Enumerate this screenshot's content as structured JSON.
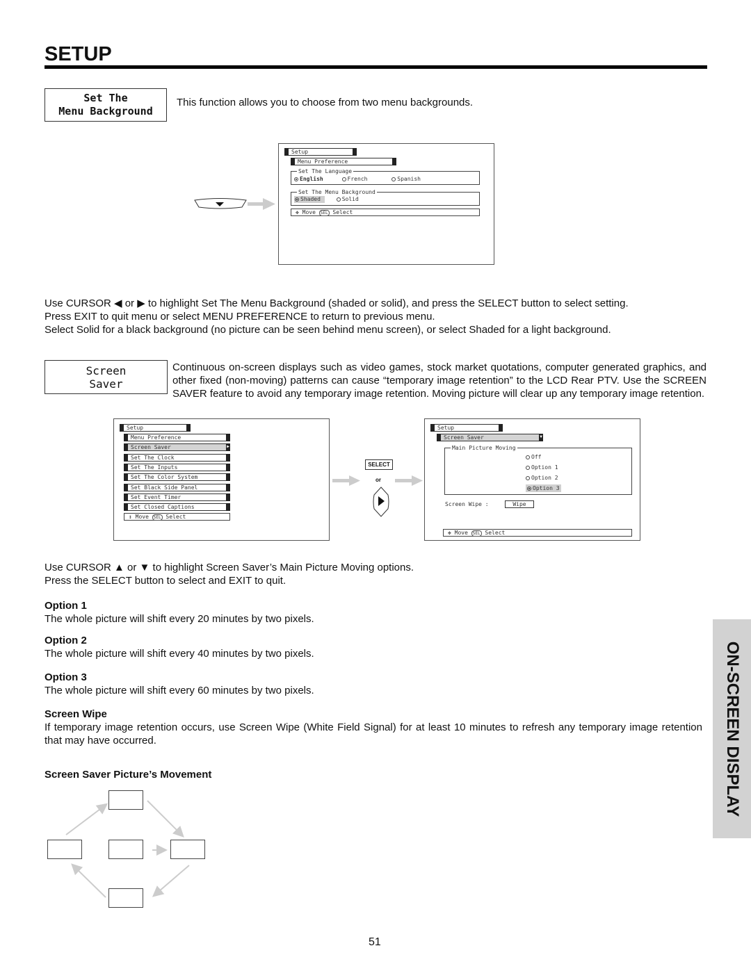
{
  "page": {
    "title": "SETUP",
    "page_number": "51",
    "side_tab": "ON-SCREEN DISPLAY"
  },
  "menu_background": {
    "label_line1": "Set The",
    "label_line2": "Menu Background",
    "intro": "This function allows you to choose from two menu backgrounds.",
    "osd": {
      "top": "Setup",
      "sub": "Menu Preference",
      "language_legend": "Set The Language",
      "languages": [
        {
          "label": "English",
          "selected": true
        },
        {
          "label": "French",
          "selected": false
        },
        {
          "label": "Spanish",
          "selected": false
        }
      ],
      "background_legend": "Set The Menu Background",
      "backgrounds": [
        {
          "label": "Shaded",
          "selected": true
        },
        {
          "label": "Solid",
          "selected": false
        }
      ],
      "footer_move": "Move",
      "footer_sel": "SEL",
      "footer_select": "Select"
    },
    "instructions": [
      "Use CURSOR ◀ or ▶ to highlight Set The Menu Background (shaded or solid), and press the SELECT button to select setting.",
      "Press EXIT to quit menu or select MENU PREFERENCE to return to previous menu.",
      "Select Solid for a black background (no picture can be seen behind menu screen), or select Shaded for a light background."
    ]
  },
  "screen_saver": {
    "label_line1": "Screen",
    "label_line2": "Saver",
    "intro": "Continuous on-screen displays such as video games, stock market quotations, computer generated graphics, and other fixed (non-moving) patterns can cause “temporary image retention” to the LCD Rear PTV.  Use the SCREEN SAVER feature to avoid any temporary image retention.  Moving picture will clear up any temporary image retention.",
    "osd_left": {
      "top": "Setup",
      "items": [
        {
          "label": "Menu Preference",
          "selected": false
        },
        {
          "label": "Screen Saver",
          "selected": true
        },
        {
          "label": "Set The Clock",
          "selected": false
        },
        {
          "label": "Set The Inputs",
          "selected": false
        },
        {
          "label": "Set The Color System",
          "selected": false
        },
        {
          "label": "Set Black Side Panel",
          "selected": false
        },
        {
          "label": "Set Event Timer",
          "selected": false
        },
        {
          "label": "Set Closed Captions",
          "selected": false
        }
      ],
      "footer_move": "Move",
      "footer_sel": "SEL",
      "footer_select": "Select"
    },
    "select_button": "SELECT",
    "or_text": "or",
    "osd_right": {
      "top": "Setup",
      "sub": "Screen Saver",
      "group_legend": "Main Picture Moving",
      "options": [
        {
          "label": "Off",
          "selected": false
        },
        {
          "label": "Option 1",
          "selected": false
        },
        {
          "label": "Option 2",
          "selected": false
        },
        {
          "label": "Option 3",
          "selected": true
        }
      ],
      "wipe_label": "Screen Wipe :",
      "wipe_button": "Wipe",
      "footer_move": "Move",
      "footer_sel": "SEL",
      "footer_select": "Select"
    },
    "instructions": [
      "Use CURSOR ▲ or ▼ to highlight Screen Saver’s Main Picture Moving options.",
      "Press the SELECT button to select and EXIT to quit."
    ],
    "options": [
      {
        "heading": "Option 1",
        "text": "The whole picture will shift every 20 minutes by two pixels."
      },
      {
        "heading": "Option 2",
        "text": "The whole picture will shift every 40 minutes by two pixels."
      },
      {
        "heading": "Option 3",
        "text": "The whole picture will shift every 60 minutes by two pixels."
      }
    ],
    "wipe_heading": "Screen Wipe",
    "wipe_text": "If temporary image retention occurs, use Screen Wipe (White Field Signal) for at least 10 minutes to refresh any temporary image retention that may have occurred.",
    "movement_heading": "Screen Saver Picture’s Movement"
  },
  "icons": {
    "cursor_down_button": "down-triangle",
    "cursor_right_button": "right-triangle",
    "arrow": "right-arrow",
    "move": "four-way-arrow",
    "updown": "up-down-arrow"
  }
}
